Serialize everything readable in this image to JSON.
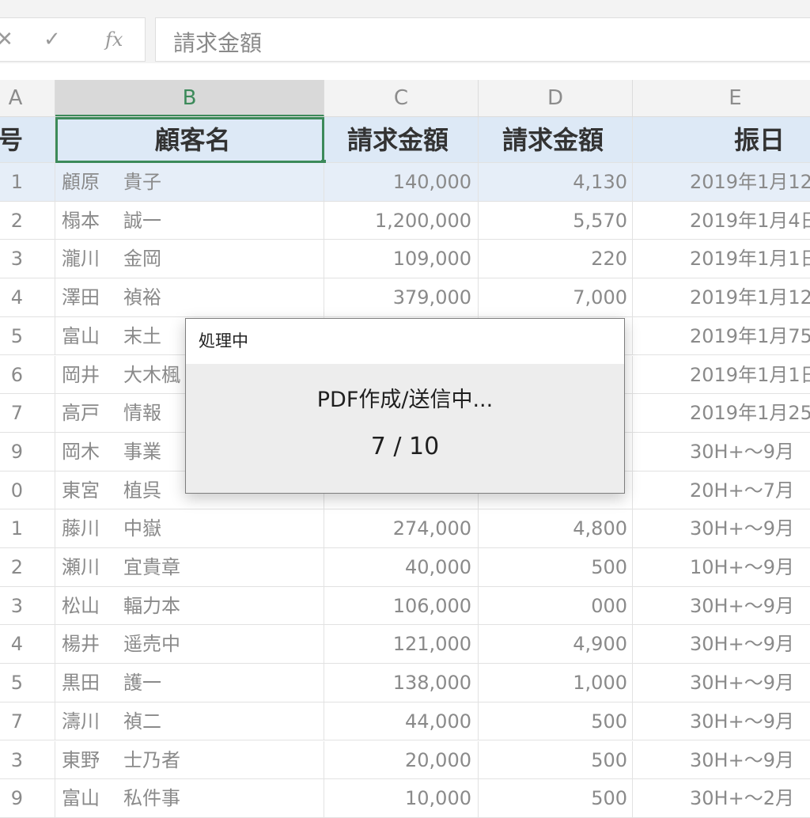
{
  "formula_bar": {
    "cancel_icon": "✕",
    "enter_icon": "✓",
    "fx_label": "fx",
    "value": "請求金額"
  },
  "columns": [
    "A",
    "B",
    "C",
    "D",
    "E"
  ],
  "header_row": {
    "c0": "号",
    "c1": "顧客名",
    "c2": "請求金額",
    "c3": "請求金額",
    "c4": "振日"
  },
  "rows": [
    {
      "no": "1",
      "family": "顧原",
      "given": "貴子",
      "c": "140,000",
      "d": "4,130",
      "e": "2019年1月12"
    },
    {
      "no": "2",
      "family": "榻本",
      "given": "誠一",
      "c": "1,200,000",
      "d": "5,570",
      "e": "2019年1月4日"
    },
    {
      "no": "3",
      "family": "瀧川",
      "given": "金岡",
      "c": "109,000",
      "d": "220",
      "e": "2019年1月1日"
    },
    {
      "no": "4",
      "family": "澤田",
      "given": "禎裕",
      "c": "379,000",
      "d": "7,000",
      "e": "2019年1月12"
    },
    {
      "no": "5",
      "family": "富山",
      "given": "末土",
      "c": "",
      "d": "",
      "e": "2019年1月75"
    },
    {
      "no": "6",
      "family": "岡井",
      "given": "大木楓",
      "c": "",
      "d": "",
      "e": "2019年1月1日"
    },
    {
      "no": "7",
      "family": "高戸",
      "given": "情報",
      "c": "",
      "d": "",
      "e": "2019年1月25"
    },
    {
      "no": "9",
      "family": "岡木",
      "given": "事業",
      "c": "",
      "d": "",
      "e": "30H+～9月"
    },
    {
      "no": "0",
      "family": "東宮",
      "given": "植呉",
      "c": "",
      "d": "",
      "e": "20H+～7月"
    },
    {
      "no": "1",
      "family": "藤川",
      "given": "中嶽",
      "c": "274,000",
      "d": "4,800",
      "e": "30H+～9月"
    },
    {
      "no": "2",
      "family": "瀬川",
      "given": "宜貴章",
      "c": "40,000",
      "d": "500",
      "e": "10H+～9月"
    },
    {
      "no": "3",
      "family": "松山",
      "given": "輻力本",
      "c": "106,000",
      "d": "000",
      "e": "30H+～9月"
    },
    {
      "no": "4",
      "family": "楊井",
      "given": "遥売中",
      "c": "121,000",
      "d": "4,900",
      "e": "30H+～9月"
    },
    {
      "no": "5",
      "family": "黒田",
      "given": "護一",
      "c": "138,000",
      "d": "1,000",
      "e": "30H+～9月"
    },
    {
      "no": "7",
      "family": "濤川",
      "given": "禎二",
      "c": "44,000",
      "d": "500",
      "e": "30H+～9月"
    },
    {
      "no": "3",
      "family": "東野",
      "given": "士乃者",
      "c": "20,000",
      "d": "500",
      "e": "30H+～9月"
    },
    {
      "no": "9",
      "family": "富山",
      "given": "私件事",
      "c": "10,000",
      "d": "500",
      "e": "30H+～2月"
    }
  ],
  "dialog": {
    "title": "処理中",
    "message": "PDF作成/送信中...",
    "progress": "7 / 10",
    "progress_current": 7,
    "progress_total": 10
  }
}
